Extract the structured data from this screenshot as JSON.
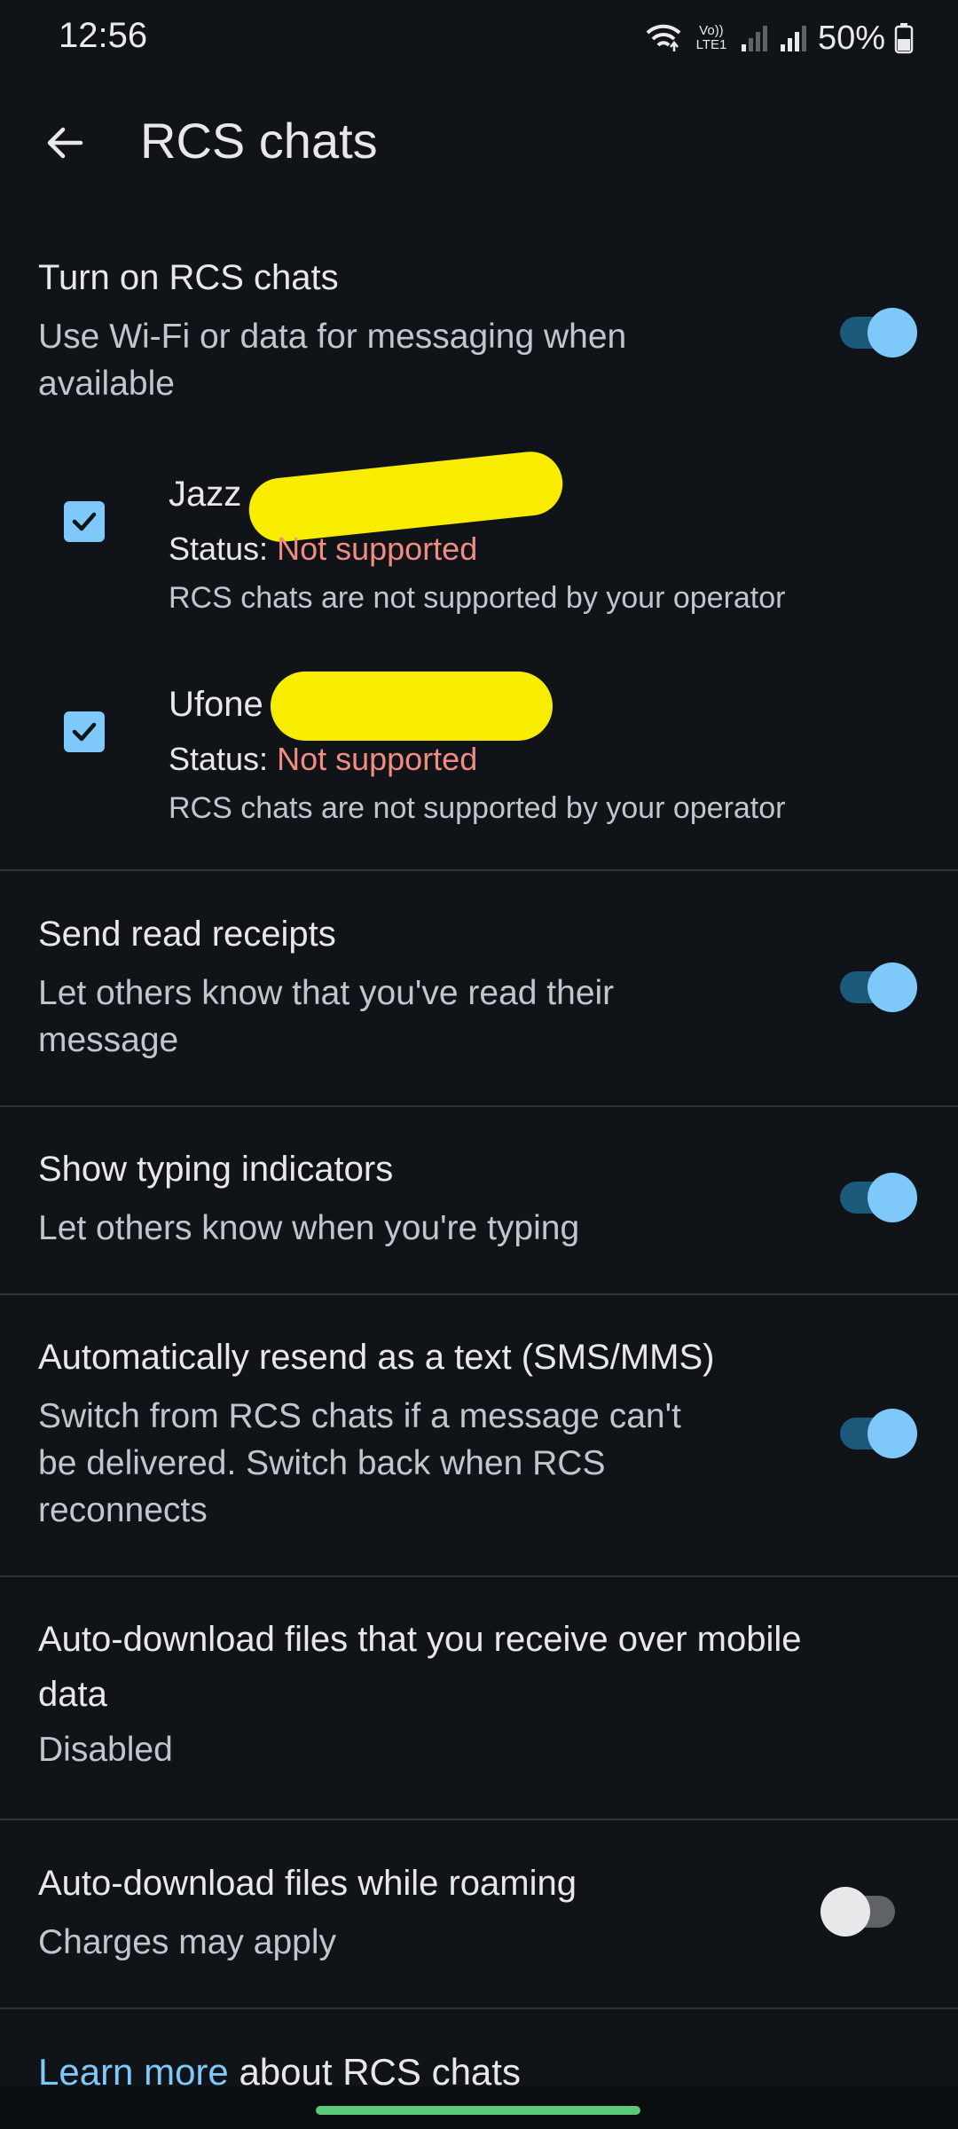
{
  "status_bar": {
    "time": "12:56",
    "battery": "50%",
    "network_label": "Vo)) LTE1",
    "icons": [
      "wifi-icon",
      "volte-icon",
      "signal-icon",
      "signal-icon",
      "battery-icon"
    ]
  },
  "header": {
    "title": "RCS chats",
    "back_icon": "arrow-back-icon"
  },
  "rcs": {
    "title": "Turn on RCS chats",
    "subtitle_line1": "Use Wi-Fi or data for messaging when",
    "subtitle_line2": "available",
    "enabled": true
  },
  "sims": [
    {
      "name": "Jazz",
      "status_label": "Status:",
      "status_value": "Not supported",
      "note": "RCS chats are not supported by your operator",
      "checked": true
    },
    {
      "name": "Ufone",
      "status_label": "Status:",
      "status_value": "Not supported",
      "note": "RCS chats are not supported by your operator",
      "checked": true
    }
  ],
  "read_receipts": {
    "title": "Send read receipts",
    "subtitle_line1": "Let others know that you've read their",
    "subtitle_line2": "message",
    "enabled": true
  },
  "typing": {
    "title": "Show typing indicators",
    "subtitle": "Let others know when you're typing",
    "enabled": true
  },
  "resend": {
    "title": "Automatically resend as a text (SMS/MMS)",
    "subtitle_line1": "Switch from RCS chats if a message can't",
    "subtitle_line2": "be delivered. Switch back when RCS",
    "subtitle_line3": "reconnects",
    "enabled": true
  },
  "auto_download": {
    "title_line1": "Auto-download files that you receive over mobile",
    "title_line2": "data",
    "value": "Disabled"
  },
  "roaming": {
    "title": "Auto-download files while roaming",
    "subtitle": "Charges may apply",
    "enabled": false
  },
  "footer": {
    "link_text": "Learn more",
    "rest_text": " about RCS chats"
  },
  "colors": {
    "background": "#101418",
    "accent": "#7ec8fa",
    "error": "#f28b82",
    "nav_handle": "#5cc978"
  }
}
